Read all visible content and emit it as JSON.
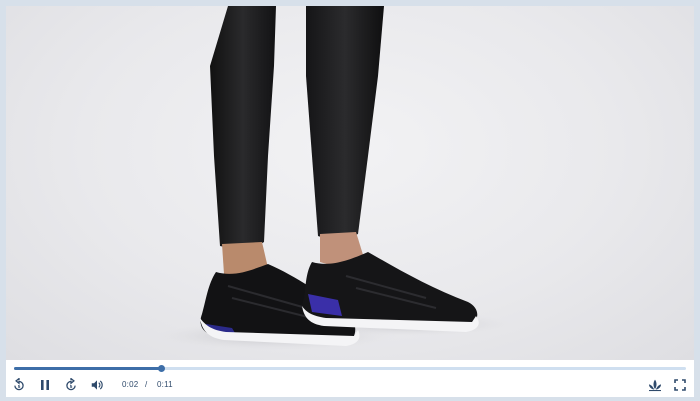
{
  "player": {
    "current_time": "0:02",
    "time_separator": "/",
    "duration": "0:11",
    "progress_fraction": 0.219
  },
  "colors": {
    "accent": "#3d6ea8",
    "track": "#cfdff0",
    "frame": "#d7e0ea"
  },
  "icons": {
    "rewind": "replay-5-icon",
    "pause": "pause-icon",
    "forward": "forward-5-icon",
    "volume": "volume-icon",
    "brand": "adidas-trefoil-logo",
    "fullscreen": "fullscreen-icon"
  }
}
